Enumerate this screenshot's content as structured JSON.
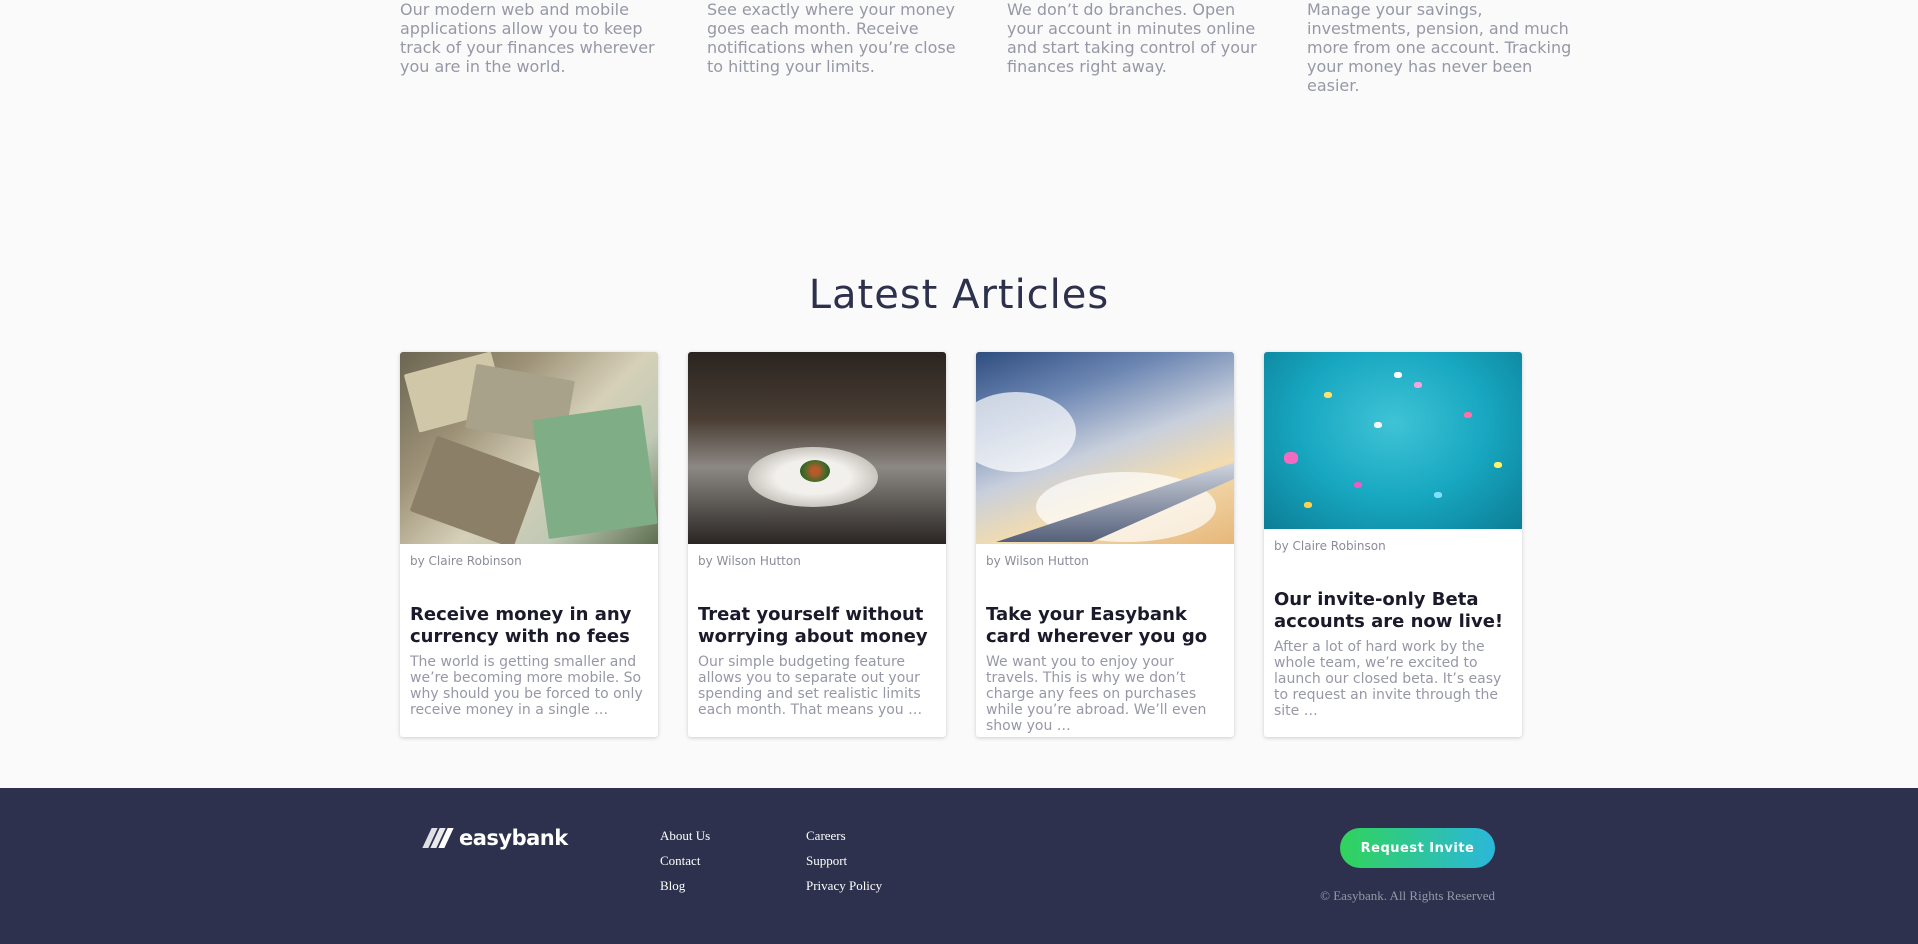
{
  "features": [
    {
      "text": "Our modern web and mobile applications allow you to keep track of your finances wherever you are in the world."
    },
    {
      "text": "See exactly where your money goes each month. Receive notifications when you’re close to hitting your limits."
    },
    {
      "text": "We don’t do branches. Open your account in minutes online and start taking control of your finances right away."
    },
    {
      "text": "Manage your savings, investments, pension, and much more from one account. Tracking your money has never been easier."
    }
  ],
  "articles": {
    "heading": "Latest Articles",
    "items": [
      {
        "author": "by Claire Robinson",
        "title": "Receive money in any currency with no fees",
        "excerpt": "The world is getting smaller and we’re becoming more mobile. So why should you be forced to only receive money in a single …"
      },
      {
        "author": "by Wilson Hutton",
        "title": "Treat yourself without worrying about money",
        "excerpt": "Our simple budgeting feature allows you to separate out your spending and set realistic limits each month. That means you …"
      },
      {
        "author": "by Wilson Hutton",
        "title": "Take your Easybank card wherever you go",
        "excerpt": "We want you to enjoy your travels. This is why we don’t charge any fees on purchases while you’re abroad. We’ll even show you …"
      },
      {
        "author": "by Claire Robinson",
        "title": "Our invite-only Beta accounts are now live!",
        "excerpt": "After a lot of hard work by the whole team, we’re excited to launch our closed beta. It’s easy to request an invite through the site …"
      }
    ]
  },
  "footer": {
    "logo": "easybank",
    "links_col1": [
      "About Us",
      "Contact",
      "Blog"
    ],
    "links_col2": [
      "Careers",
      "Support",
      "Privacy Policy"
    ],
    "cta": "Request Invite",
    "copyright": "© Easybank. All Rights Reserved",
    "colors": {
      "background": "#2d314d",
      "cta_start": "#31d35c",
      "cta_end": "#2bb7da"
    }
  }
}
